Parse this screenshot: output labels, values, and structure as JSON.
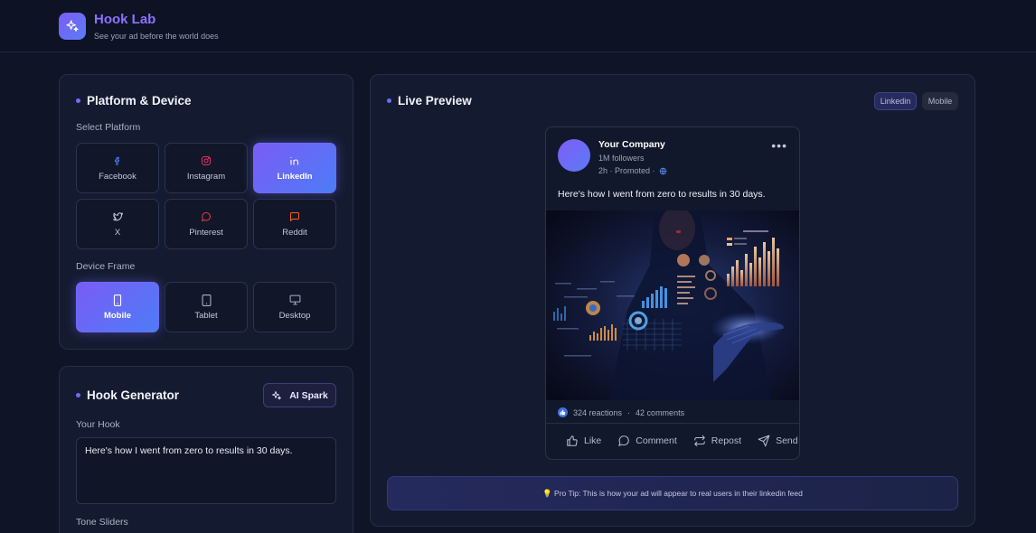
{
  "app": {
    "title": "Hook Lab",
    "tagline": "See your ad before the world does"
  },
  "left_panel": {
    "title": "Platform & Device",
    "platform_label": "Select Platform",
    "platforms": [
      {
        "label": "Facebook",
        "icon": "facebook-icon",
        "active": false,
        "color": "#4a7cf5"
      },
      {
        "label": "Instagram",
        "icon": "instagram-icon",
        "active": false,
        "color": "#e1306c"
      },
      {
        "label": "LinkedIn",
        "icon": "linkedin-icon",
        "active": true,
        "color": "#ffffff"
      },
      {
        "label": "X",
        "icon": "twitter-icon",
        "active": false,
        "color": "#c8cde0"
      },
      {
        "label": "Pinterest",
        "icon": "pinterest-icon",
        "active": false,
        "color": "#e23b3b"
      },
      {
        "label": "Reddit",
        "icon": "reddit-icon",
        "active": false,
        "color": "#ff5a1f"
      }
    ],
    "device_label": "Device Frame",
    "devices": [
      {
        "label": "Mobile",
        "icon": "mobile-icon",
        "active": true
      },
      {
        "label": "Tablet",
        "icon": "tablet-icon",
        "active": false
      },
      {
        "label": "Desktop",
        "icon": "desktop-icon",
        "active": false
      }
    ]
  },
  "hook_panel": {
    "title": "Hook Generator",
    "ai_button": "AI Spark",
    "hook_label": "Your Hook",
    "hook_value": "Here's how I went from zero to results in 30 days.",
    "tone_label": "Tone Sliders"
  },
  "preview": {
    "title": "Live Preview",
    "platform_badge": "Linkedin",
    "device_badge": "Mobile",
    "post": {
      "company": "Your Company",
      "followers": "1M followers",
      "meta": "2h · Promoted ·",
      "text": "Here's how I went from zero to results in 30 days.",
      "reactions": "324 reactions",
      "comments": "42 comments",
      "actions": [
        "Like",
        "Comment",
        "Repost",
        "Send"
      ]
    },
    "tip": "💡 Pro Tip: This is how your ad will appear to real users in their linkedin feed"
  },
  "colors": {
    "accent": "#6c6ff5",
    "brand_gradient_start": "#7b5cf5",
    "brand_gradient_end": "#4d7cf6",
    "background": "#0f1527",
    "panel": "#141b30"
  }
}
